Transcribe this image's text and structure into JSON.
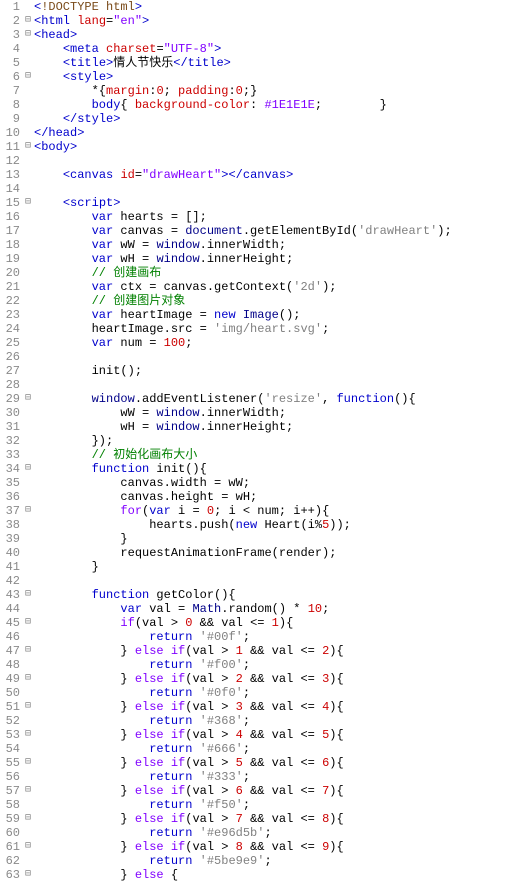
{
  "lines": [
    {
      "n": 1,
      "fold": "",
      "html": "<span class='t-punc'>&lt;</span><span class='t-decl'>!DOCTYPE html</span><span class='t-punc'>&gt;</span>"
    },
    {
      "n": 2,
      "fold": "⊟",
      "html": "<span class='t-punc'>&lt;</span><span class='t-tag'>html</span> <span class='t-attn'>lang</span>=<span class='t-attv'>\"en\"</span><span class='t-punc'>&gt;</span>"
    },
    {
      "n": 3,
      "fold": "⊟",
      "html": "<span class='t-punc'>&lt;</span><span class='t-tag'>head</span><span class='t-punc'>&gt;</span>"
    },
    {
      "n": 4,
      "fold": "",
      "html": "    <span class='t-punc'>&lt;</span><span class='t-tag'>meta</span> <span class='t-attn'>charset</span>=<span class='t-attv'>\"UTF-8\"</span><span class='t-punc'>&gt;</span>"
    },
    {
      "n": 5,
      "fold": "",
      "html": "    <span class='t-punc'>&lt;</span><span class='t-tag'>title</span><span class='t-punc'>&gt;</span>情人节快乐<span class='t-punc'>&lt;/</span><span class='t-tag'>title</span><span class='t-punc'>&gt;</span>"
    },
    {
      "n": 6,
      "fold": "⊟",
      "html": "    <span class='t-punc'>&lt;</span><span class='t-tag'>style</span><span class='t-punc'>&gt;</span>"
    },
    {
      "n": 7,
      "fold": "",
      "html": "        *{<span class='t-cssk'>margin</span>:<span class='t-num'>0</span>; <span class='t-cssk'>padding</span>:<span class='t-num'>0</span>;}"
    },
    {
      "n": 8,
      "fold": "",
      "html": "        <span class='t-tag'>body</span>{ <span class='t-cssk'>background-color</span>: <span class='t-cssv'>#1E1E1E</span>;        }"
    },
    {
      "n": 9,
      "fold": "",
      "html": "    <span class='t-punc'>&lt;/</span><span class='t-tag'>style</span><span class='t-punc'>&gt;</span>"
    },
    {
      "n": 10,
      "fold": "",
      "html": "<span class='t-punc'>&lt;/</span><span class='t-tag'>head</span><span class='t-punc'>&gt;</span>"
    },
    {
      "n": 11,
      "fold": "⊟",
      "html": "<span class='t-punc'>&lt;</span><span class='t-tag'>body</span><span class='t-punc'>&gt;</span>"
    },
    {
      "n": 12,
      "fold": "",
      "html": ""
    },
    {
      "n": 13,
      "fold": "",
      "html": "    <span class='t-punc'>&lt;</span><span class='t-tag'>canvas</span> <span class='t-attn'>id</span>=<span class='t-attv'>\"drawHeart\"</span><span class='t-punc'>&gt;&lt;/</span><span class='t-tag'>canvas</span><span class='t-punc'>&gt;</span>"
    },
    {
      "n": 14,
      "fold": "",
      "html": ""
    },
    {
      "n": 15,
      "fold": "⊟",
      "html": "    <span class='t-punc'>&lt;</span><span class='t-tag'>script</span><span class='t-punc'>&gt;</span>"
    },
    {
      "n": 16,
      "fold": "",
      "html": "        <span class='t-kw'>var</span> hearts = [];"
    },
    {
      "n": 17,
      "fold": "",
      "html": "        <span class='t-kw'>var</span> canvas = <span class='t-glob'>document</span>.getElementById(<span class='t-str'>'drawHeart'</span>);"
    },
    {
      "n": 18,
      "fold": "",
      "html": "        <span class='t-kw'>var</span> wW = <span class='t-glob'>window</span>.innerWidth;"
    },
    {
      "n": 19,
      "fold": "",
      "html": "        <span class='t-kw'>var</span> wH = <span class='t-glob'>window</span>.innerHeight;"
    },
    {
      "n": 20,
      "fold": "",
      "html": "        <span class='t-cmt'>// 创建画布</span>"
    },
    {
      "n": 21,
      "fold": "",
      "html": "        <span class='t-kw'>var</span> ctx = canvas.getContext(<span class='t-str'>'2d'</span>);"
    },
    {
      "n": 22,
      "fold": "",
      "html": "        <span class='t-cmt'>// 创建图片对象</span>"
    },
    {
      "n": 23,
      "fold": "",
      "html": "        <span class='t-kw'>var</span> heartImage = <span class='t-kw'>new</span> <span class='t-glob'>Image</span>();"
    },
    {
      "n": 24,
      "fold": "",
      "html": "        heartImage.src = <span class='t-str'>'img/heart.svg'</span>;"
    },
    {
      "n": 25,
      "fold": "",
      "html": "        <span class='t-kw'>var</span> num = <span class='t-num'>100</span>;"
    },
    {
      "n": 26,
      "fold": "",
      "html": ""
    },
    {
      "n": 27,
      "fold": "",
      "html": "        init();"
    },
    {
      "n": 28,
      "fold": "",
      "html": ""
    },
    {
      "n": 29,
      "fold": "⊟",
      "html": "        <span class='t-glob'>window</span>.addEventListener(<span class='t-str'>'resize'</span>, <span class='t-kw'>function</span>(){"
    },
    {
      "n": 30,
      "fold": "",
      "html": "            wW = <span class='t-glob'>window</span>.innerWidth;"
    },
    {
      "n": 31,
      "fold": "",
      "html": "            wH = <span class='t-glob'>window</span>.innerHeight;"
    },
    {
      "n": 32,
      "fold": "",
      "html": "        });"
    },
    {
      "n": 33,
      "fold": "",
      "html": "        <span class='t-cmt'>// 初始化画布大小</span>"
    },
    {
      "n": 34,
      "fold": "⊟",
      "html": "        <span class='t-kw'>function</span> init(){"
    },
    {
      "n": 35,
      "fold": "",
      "html": "            canvas.width = wW;"
    },
    {
      "n": 36,
      "fold": "",
      "html": "            canvas.height = wH;"
    },
    {
      "n": 37,
      "fold": "⊟",
      "html": "            <span class='t-kw2'>for</span>(<span class='t-kw'>var</span> i = <span class='t-num'>0</span>; i &lt; num; i++){"
    },
    {
      "n": 38,
      "fold": "",
      "html": "                hearts.push(<span class='t-kw'>new</span> Heart(i%<span class='t-num'>5</span>));"
    },
    {
      "n": 39,
      "fold": "",
      "html": "            }"
    },
    {
      "n": 40,
      "fold": "",
      "html": "            requestAnimationFrame(render);"
    },
    {
      "n": 41,
      "fold": "",
      "html": "        }"
    },
    {
      "n": 42,
      "fold": "",
      "html": ""
    },
    {
      "n": 43,
      "fold": "⊟",
      "html": "        <span class='t-kw'>function</span> getColor(){"
    },
    {
      "n": 44,
      "fold": "",
      "html": "            <span class='t-kw'>var</span> val = <span class='t-glob'>Math</span>.random() * <span class='t-num'>10</span>;"
    },
    {
      "n": 45,
      "fold": "⊟",
      "html": "            <span class='t-kw2'>if</span>(val &gt; <span class='t-num'>0</span> &amp;&amp; val &lt;= <span class='t-num'>1</span>){"
    },
    {
      "n": 46,
      "fold": "",
      "html": "                <span class='t-kw'>return</span> <span class='t-str'>'#00f'</span>;"
    },
    {
      "n": 47,
      "fold": "⊟",
      "html": "            } <span class='t-kw2'>else if</span>(val &gt; <span class='t-num'>1</span> &amp;&amp; val &lt;= <span class='t-num'>2</span>){"
    },
    {
      "n": 48,
      "fold": "",
      "html": "                <span class='t-kw'>return</span> <span class='t-str'>'#f00'</span>;"
    },
    {
      "n": 49,
      "fold": "⊟",
      "html": "            } <span class='t-kw2'>else if</span>(val &gt; <span class='t-num'>2</span> &amp;&amp; val &lt;= <span class='t-num'>3</span>){"
    },
    {
      "n": 50,
      "fold": "",
      "html": "                <span class='t-kw'>return</span> <span class='t-str'>'#0f0'</span>;"
    },
    {
      "n": 51,
      "fold": "⊟",
      "html": "            } <span class='t-kw2'>else if</span>(val &gt; <span class='t-num'>3</span> &amp;&amp; val &lt;= <span class='t-num'>4</span>){"
    },
    {
      "n": 52,
      "fold": "",
      "html": "                <span class='t-kw'>return</span> <span class='t-str'>'#368'</span>;"
    },
    {
      "n": 53,
      "fold": "⊟",
      "html": "            } <span class='t-kw2'>else if</span>(val &gt; <span class='t-num'>4</span> &amp;&amp; val &lt;= <span class='t-num'>5</span>){"
    },
    {
      "n": 54,
      "fold": "",
      "html": "                <span class='t-kw'>return</span> <span class='t-str'>'#666'</span>;"
    },
    {
      "n": 55,
      "fold": "⊟",
      "html": "            } <span class='t-kw2'>else if</span>(val &gt; <span class='t-num'>5</span> &amp;&amp; val &lt;= <span class='t-num'>6</span>){"
    },
    {
      "n": 56,
      "fold": "",
      "html": "                <span class='t-kw'>return</span> <span class='t-str'>'#333'</span>;"
    },
    {
      "n": 57,
      "fold": "⊟",
      "html": "            } <span class='t-kw2'>else if</span>(val &gt; <span class='t-num'>6</span> &amp;&amp; val &lt;= <span class='t-num'>7</span>){"
    },
    {
      "n": 58,
      "fold": "",
      "html": "                <span class='t-kw'>return</span> <span class='t-str'>'#f50'</span>;"
    },
    {
      "n": 59,
      "fold": "⊟",
      "html": "            } <span class='t-kw2'>else if</span>(val &gt; <span class='t-num'>7</span> &amp;&amp; val &lt;= <span class='t-num'>8</span>){"
    },
    {
      "n": 60,
      "fold": "",
      "html": "                <span class='t-kw'>return</span> <span class='t-str'>'#e96d5b'</span>;"
    },
    {
      "n": 61,
      "fold": "⊟",
      "html": "            } <span class='t-kw2'>else if</span>(val &gt; <span class='t-num'>8</span> &amp;&amp; val &lt;= <span class='t-num'>9</span>){"
    },
    {
      "n": 62,
      "fold": "",
      "html": "                <span class='t-kw'>return</span> <span class='t-str'>'#5be9e9'</span>;"
    },
    {
      "n": 63,
      "fold": "⊟",
      "html": "            } <span class='t-kw2'>else</span> {"
    }
  ]
}
